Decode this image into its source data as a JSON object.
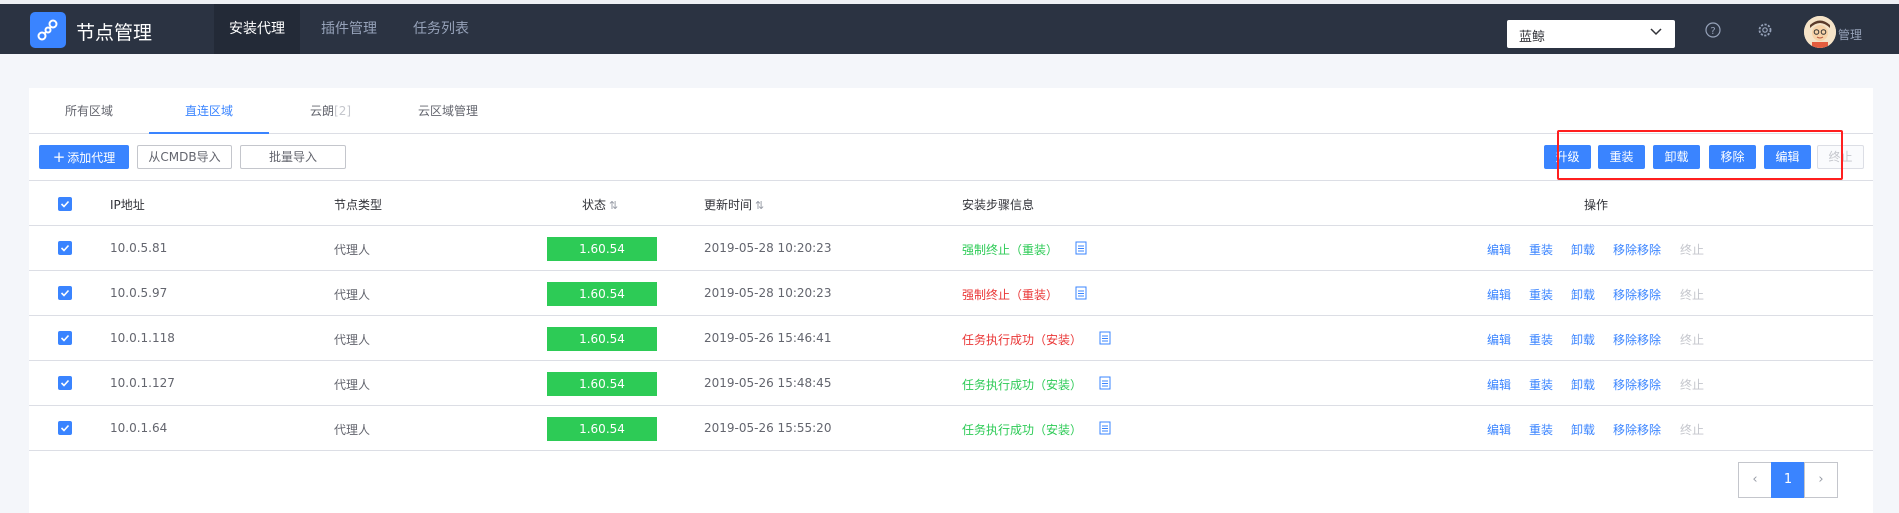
{
  "header": {
    "app_title": "节点管理",
    "nav": [
      "安装代理",
      "插件管理",
      "任务列表"
    ],
    "region": "蓝鲸",
    "user": "管理"
  },
  "tabs": [
    {
      "label": "所有区域",
      "count": ""
    },
    {
      "label": "直连区域",
      "count": ""
    },
    {
      "label": "云朗",
      "count": "[2]"
    },
    {
      "label": "云区域管理",
      "count": ""
    }
  ],
  "toolbar": {
    "add": "添加代理",
    "import_cmdb": "从CMDB导入",
    "batch_import": "批量导入",
    "upgrade": "升级",
    "reinstall": "重装",
    "uninstall": "卸载",
    "remove": "移除",
    "edit": "编辑",
    "terminate": "终止"
  },
  "table": {
    "headers": {
      "ip": "IP地址",
      "type": "节点类型",
      "status": "状态",
      "updated": "更新时间",
      "steps": "安装步骤信息",
      "ops": "操作"
    },
    "rows": [
      {
        "ip": "10.0.5.81",
        "type": "代理人",
        "version": "1.60.54",
        "time": "2019-05-28 10:20:23",
        "step": "强制终止（重装）"
      },
      {
        "ip": "10.0.5.97",
        "type": "代理人",
        "version": "1.60.54",
        "time": "2019-05-28 10:20:23",
        "step": "强制终止（重装）"
      },
      {
        "ip": "10.0.1.118",
        "type": "代理人",
        "version": "1.60.54",
        "time": "2019-05-26 15:46:41",
        "step": "任务执行成功（安装）"
      },
      {
        "ip": "10.0.1.127",
        "type": "代理人",
        "version": "1.60.54",
        "time": "2019-05-26 15:48:45",
        "step": "任务执行成功（安装）"
      },
      {
        "ip": "10.0.1.64",
        "type": "代理人",
        "version": "1.60.54",
        "time": "2019-05-26 15:55:20",
        "step": "任务执行成功（安装）"
      }
    ],
    "row_ops": [
      "编辑",
      "重装",
      "卸载",
      "移除移除",
      "终止"
    ]
  },
  "pagination": {
    "prev": "‹",
    "current": "1",
    "next": "›"
  },
  "colors": {
    "header_bg": "#2b3342",
    "primary": "#3a84ff",
    "status_green": "#2dcb56",
    "status_red": "#ea3636",
    "highlight": "#ff1f1f"
  }
}
